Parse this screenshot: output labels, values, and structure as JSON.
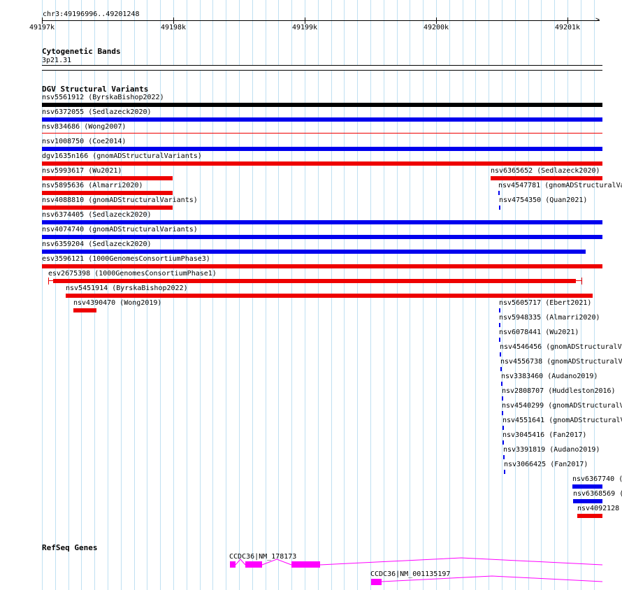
{
  "ruler": {
    "location": "chr3:49196996..49201248",
    "ticks": [
      "49197k",
      "49198k",
      "49199k",
      "49200k",
      "49201k"
    ]
  },
  "tracks": {
    "cytobands": {
      "title": "Cytogenetic Bands",
      "band": "3p21.31"
    },
    "dgv": {
      "title": "DGV Structural Variants",
      "features": [
        {
          "label": "nsv5561912 (ByrskaBishop2022)",
          "color": "#000000"
        },
        {
          "label": "nsv6372055 (Sedlazeck2020)",
          "color": "#0000ee"
        },
        {
          "label": "nsv834686 (Wong2007)",
          "color": "#ee0000"
        },
        {
          "label": "nsv1008750 (Coe2014)",
          "color": "#0000ee"
        },
        {
          "label": "dgv1635n166 (gnomADStructuralVariants)",
          "color": "#ee0000"
        },
        {
          "label": "nsv5993617 (Wu2021)",
          "color": "#ee0000"
        },
        {
          "label": "nsv5895636 (Almarri2020)",
          "color": "#ee0000"
        },
        {
          "label": "nsv4088810 (gnomADStructuralVariants)",
          "color": "#ee0000"
        },
        {
          "label": "nsv6374405 (Sedlazeck2020)",
          "color": "#0000ee"
        },
        {
          "label": "nsv4074740 (gnomADStructuralVariants)",
          "color": "#0000ee"
        },
        {
          "label": "nsv6359204 (Sedlazeck2020)",
          "color": "#0000ee"
        },
        {
          "label": "esv3596121 (1000GenomesConsortiumPhase3)",
          "color": "#ee0000"
        },
        {
          "label": "esv2675398 (1000GenomesConsortiumPhase1)",
          "color": "#ee0000"
        },
        {
          "label": "nsv5451914 (ByrskaBishop2022)",
          "color": "#ee0000"
        },
        {
          "label": "nsv4390470 (Wong2019)",
          "color": "#ee0000"
        },
        {
          "label": "nsv6365652 (Sedlazeck2020)",
          "color": "#ee0000"
        },
        {
          "label": "nsv4547781 (gnomADStructuralVa",
          "color": "#0000ee"
        },
        {
          "label": "nsv4754350 (Quan2021)",
          "color": "#0000ee"
        },
        {
          "label": "nsv5605717 (Ebert2021)",
          "color": "#0000ee"
        },
        {
          "label": "nsv5948335 (Almarri2020)",
          "color": "#0000ee"
        },
        {
          "label": "nsv6078441 (Wu2021)",
          "color": "#0000ee"
        },
        {
          "label": "nsv4546456 (gnomADStructuralVa",
          "color": "#0000ee"
        },
        {
          "label": "nsv4556738 (gnomADStructuralVa",
          "color": "#0000ee"
        },
        {
          "label": "nsv3383460 (Audano2019)",
          "color": "#0000ee"
        },
        {
          "label": "nsv2808707 (Huddleston2016)",
          "color": "#0000ee"
        },
        {
          "label": "nsv4540299 (gnomADStructuralVa",
          "color": "#0000ee"
        },
        {
          "label": "nsv4551641 (gnomADStructuralVa",
          "color": "#0000ee"
        },
        {
          "label": "nsv3045416 (Fan2017)",
          "color": "#0000ee"
        },
        {
          "label": "nsv3391819 (Audano2019)",
          "color": "#0000ee"
        },
        {
          "label": "nsv3066425 (Fan2017)",
          "color": "#0000ee"
        },
        {
          "label": "nsv6367740 (",
          "color": "#0000ee"
        },
        {
          "label": "nsv6368569 (",
          "color": "#0000ee"
        },
        {
          "label": "nsv4092128",
          "color": "#ee0000"
        }
      ]
    },
    "refseq": {
      "title": "RefSeq Genes",
      "genes": [
        {
          "label": "CCDC36|NM_178173",
          "color": "#ff00ff"
        },
        {
          "label": "CCDC36|NM_001135197",
          "color": "#ff00ff"
        }
      ]
    }
  }
}
